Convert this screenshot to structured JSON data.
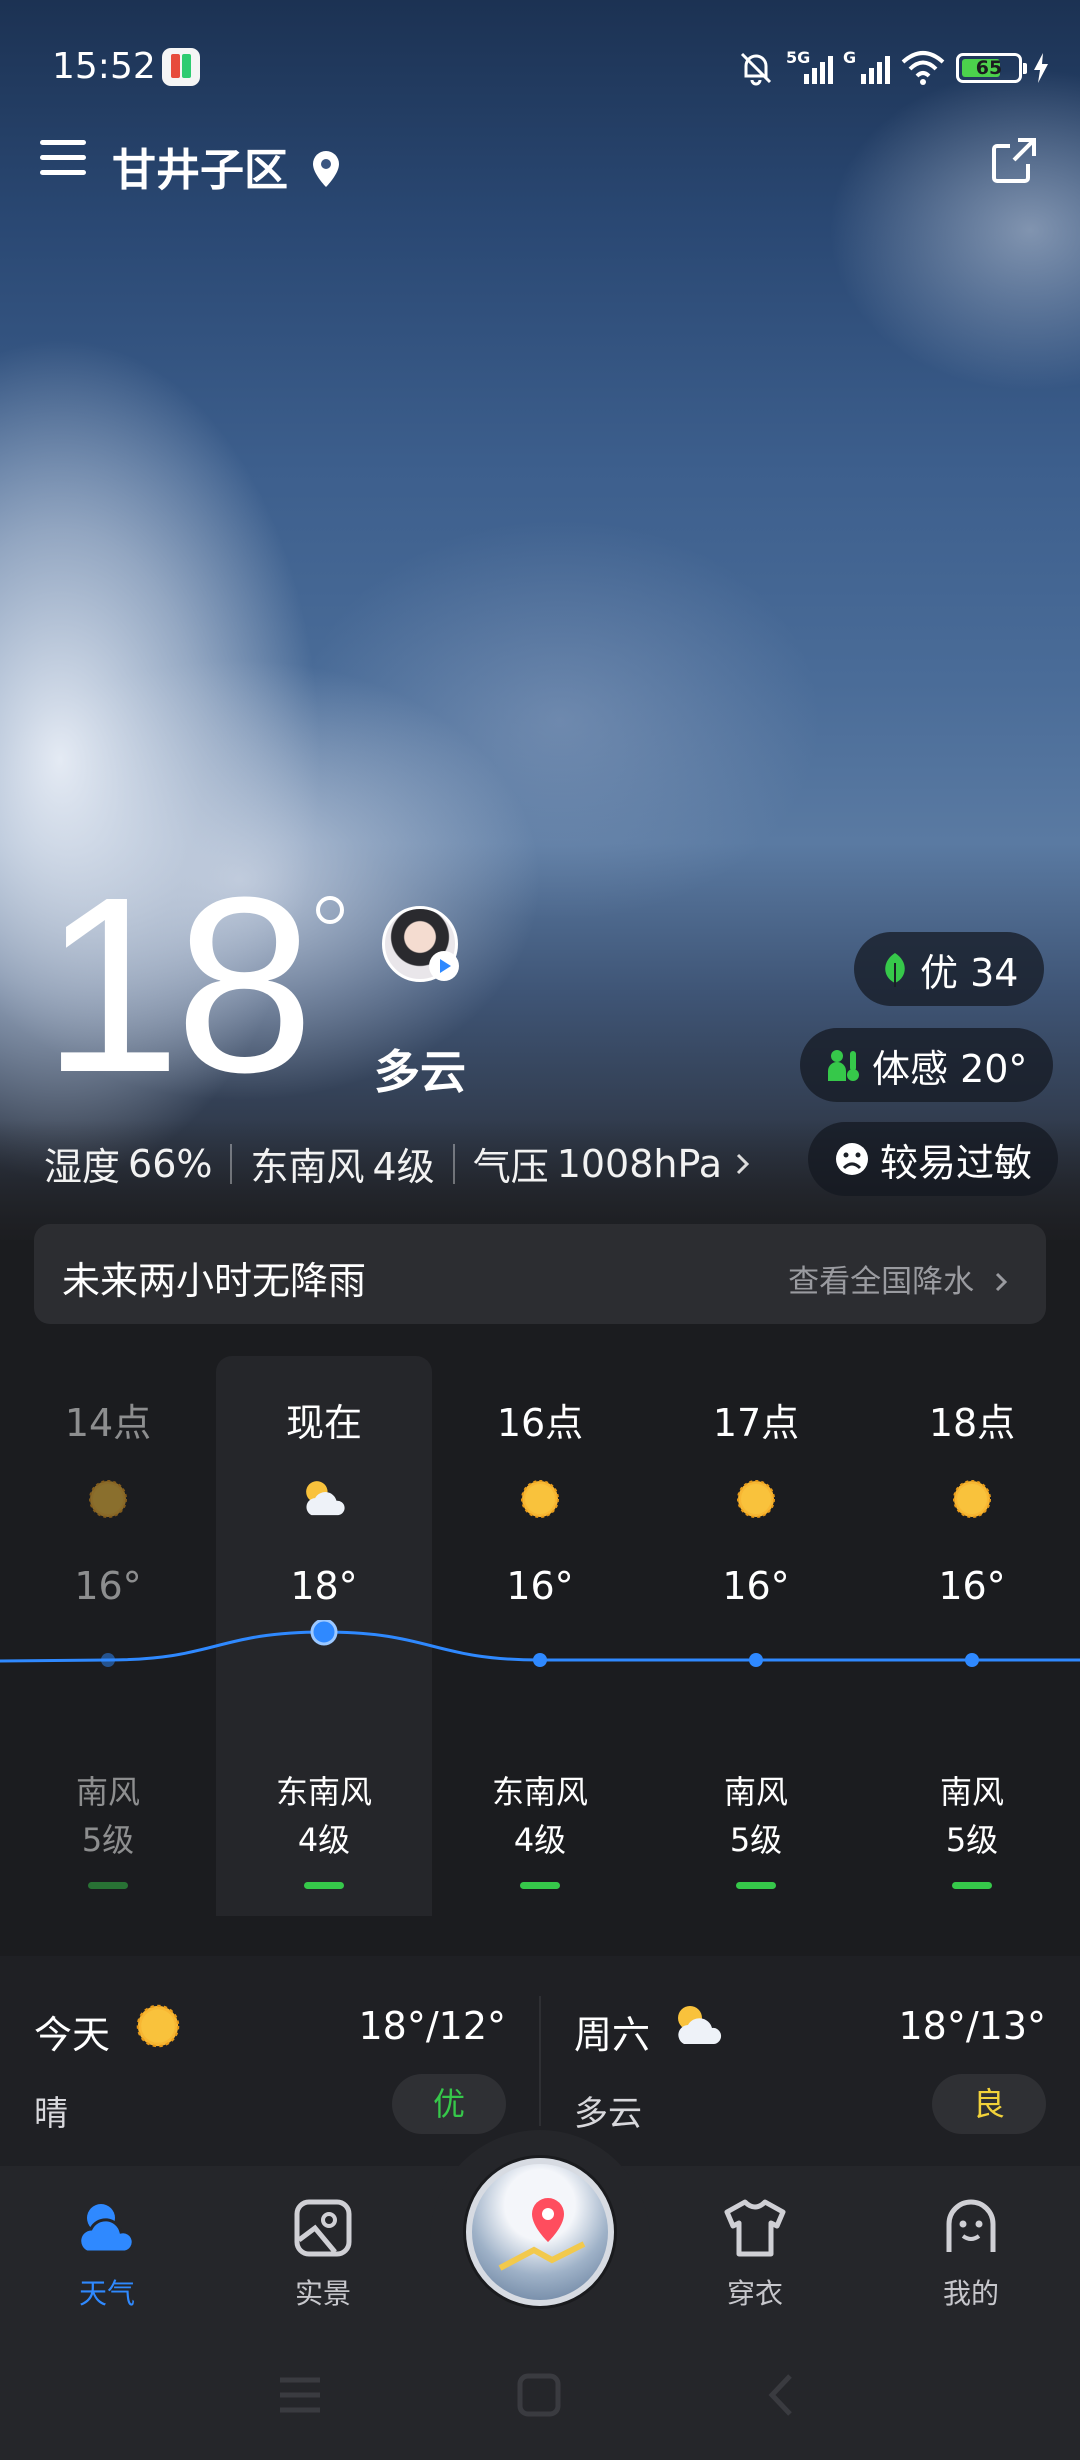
{
  "status_bar": {
    "time": "15:52",
    "network_1": "5G",
    "network_2": "G",
    "battery": "65"
  },
  "header": {
    "city": "甘井子区"
  },
  "current": {
    "temperature": "18",
    "condition": "多云",
    "aqi_label": "优 34",
    "feels_like": "体感 20°",
    "allergy": "较易过敏",
    "humidity_label": "湿度",
    "humidity_value": "66%",
    "wind_label": "东南风",
    "wind_value": "4级",
    "pressure_label": "气压",
    "pressure_value": "1008hPa"
  },
  "rain": {
    "text": "未来两小时无降雨",
    "link": "查看全国降水"
  },
  "hourly": [
    {
      "time": "14点",
      "icon": "sunny-icon",
      "temp": "16°",
      "wind": "南风",
      "level": "5级",
      "past": true
    },
    {
      "time": "现在",
      "icon": "partly-cloudy-icon",
      "temp": "18°",
      "wind": "东南风",
      "level": "4级",
      "past": false
    },
    {
      "time": "16点",
      "icon": "sunny-icon",
      "temp": "16°",
      "wind": "东南风",
      "level": "4级",
      "past": false
    },
    {
      "time": "17点",
      "icon": "sunny-icon",
      "temp": "16°",
      "wind": "南风",
      "level": "5级",
      "past": false
    },
    {
      "time": "18点",
      "icon": "sunny-icon",
      "temp": "16°",
      "wind": "南风",
      "level": "5级",
      "past": false
    }
  ],
  "daily": [
    {
      "day": "今天",
      "icon": "sunny-icon",
      "temps": "18°/12°",
      "condition": "晴",
      "aqi": "优",
      "aqi_color": "#36c84a"
    },
    {
      "day": "周六",
      "icon": "partly-cloudy-icon",
      "temps": "18°/13°",
      "condition": "多云",
      "aqi": "良",
      "aqi_color": "#f2d23a"
    }
  ],
  "nav": [
    {
      "label": "天气",
      "icon": "weather-icon",
      "active": true
    },
    {
      "label": "实景",
      "icon": "photo-icon",
      "active": false
    },
    {
      "label": "穿衣",
      "icon": "shirt-icon",
      "active": false
    },
    {
      "label": "我的",
      "icon": "profile-icon",
      "active": false
    }
  ],
  "colors": {
    "accent": "#2f89ff",
    "good": "#36c84a",
    "moderate": "#f2d23a",
    "sun": "#f7b733"
  }
}
